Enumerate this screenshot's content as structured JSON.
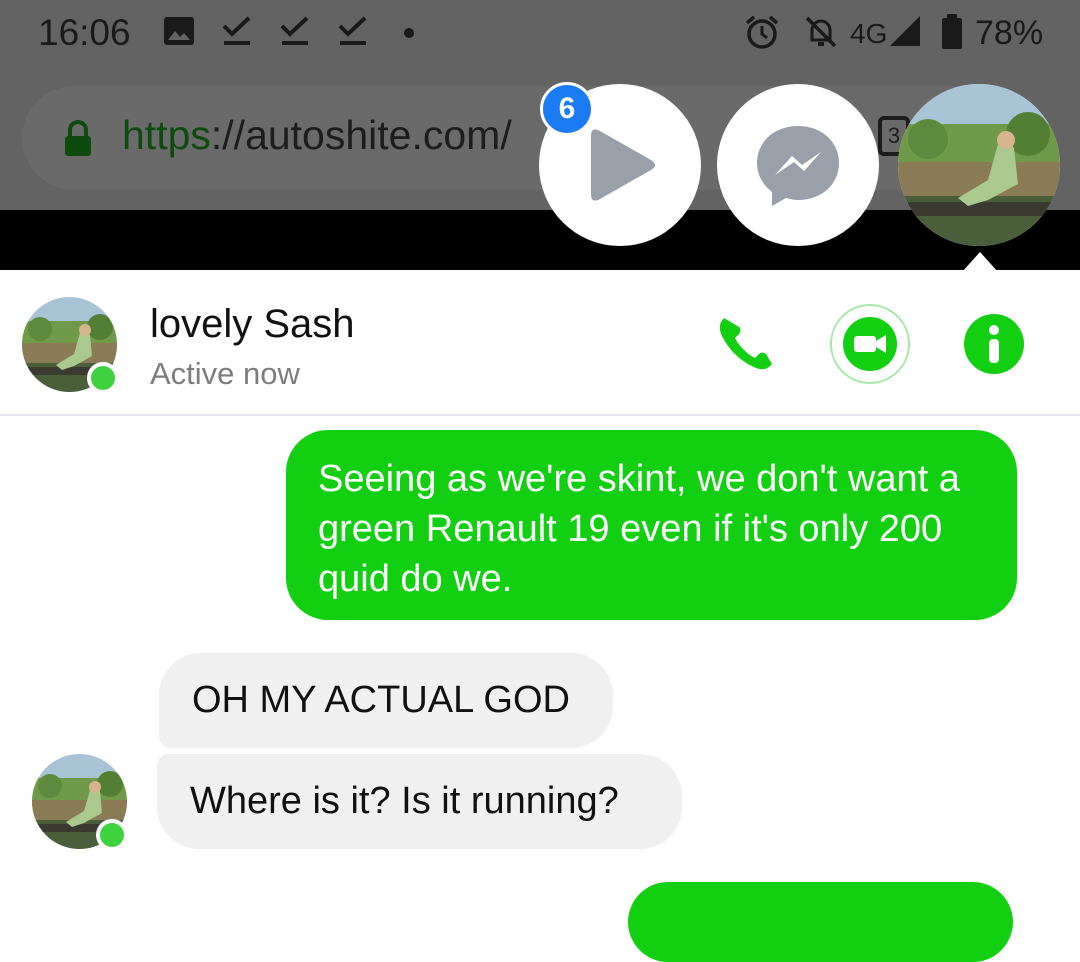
{
  "status_bar": {
    "time": "16:06",
    "notification_icons": [
      "image-icon",
      "check-icon",
      "check-icon",
      "check-icon",
      "dot-icon"
    ],
    "alarm_icon": "alarm-icon",
    "mute_icon": "notifications-off-icon",
    "network": "4G",
    "battery": "78%"
  },
  "browser": {
    "url_scheme": "https",
    "url_rest": "://autoshite.com/",
    "tab_count": "3"
  },
  "chat_heads": {
    "unread_badge": "6",
    "items": [
      "video-play-icon",
      "messenger-icon",
      "contact-avatar"
    ]
  },
  "chat": {
    "contact_name": "lovely Sash",
    "contact_status": "Active now",
    "accent_color": "#12cf12",
    "actions": [
      "phone-icon",
      "video-call-icon",
      "info-icon"
    ]
  },
  "messages": [
    {
      "direction": "outgoing",
      "text": "Seeing as we're skint, we don't want a green Renault 19 even if it's only 200 quid do we."
    },
    {
      "direction": "incoming",
      "text": "OH MY ACTUAL GOD"
    },
    {
      "direction": "incoming",
      "text": "Where is it? Is it running?"
    },
    {
      "direction": "outgoing",
      "text": ""
    }
  ]
}
